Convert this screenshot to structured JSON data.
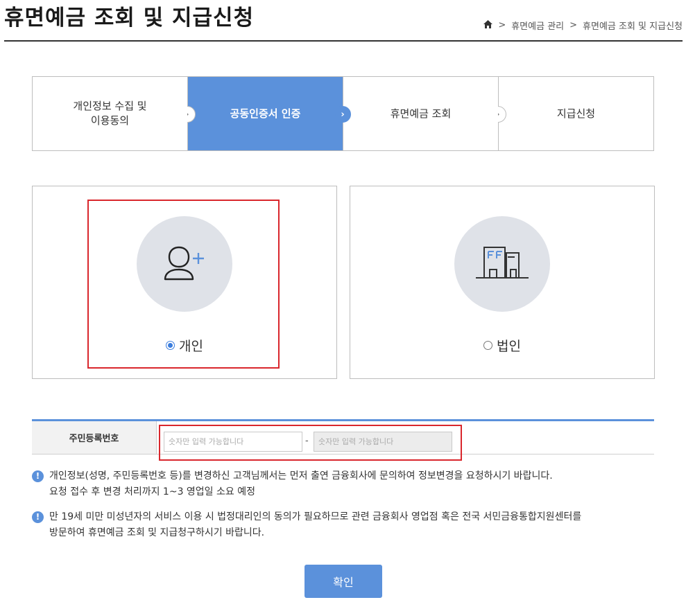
{
  "header": {
    "title": "휴면예금 조회 및 지급신청",
    "breadcrumb": {
      "home_icon": "home-icon",
      "items": [
        "휴면예금 관리",
        "휴면예금 조회 및 지급신청"
      ],
      "separator": ">"
    }
  },
  "steps": [
    {
      "label": "개인정보 수집 및\n이용동의",
      "active": false
    },
    {
      "label": "공동인증서 인증",
      "active": true
    },
    {
      "label": "휴면예금 조회",
      "active": false
    },
    {
      "label": "지급신청",
      "active": false
    }
  ],
  "step_arrow_glyph": "›",
  "member_types": {
    "personal": {
      "label": "개인",
      "icon": "person-add-icon",
      "selected": true
    },
    "corporate": {
      "label": "법인",
      "icon": "building-icon",
      "selected": false
    }
  },
  "rrn_form": {
    "label": "주민등록번호",
    "first_placeholder": "숫자만 입력 가능합니다",
    "second_placeholder": "숫자만 입력 가능합니다",
    "separator": "-"
  },
  "notices": [
    {
      "icon": "exclamation-icon",
      "glyph": "!",
      "text": "개인정보(성명, 주민등록번호 등)를 변경하신 고객님께서는 먼저 출연 금융회사에 문의하여 정보변경을 요청하시기 바랍니다.\n요청 접수 후 변경 처리까지 1~3 영업일 소요 예정"
    },
    {
      "icon": "exclamation-icon",
      "glyph": "!",
      "text": "만 19세 미만 미성년자의 서비스 이용 시 법정대리인의 동의가 필요하므로 관련 금융회사 영업점 혹은 전국 서민금융통합지원센터를\n방문하여 휴면예금 조회 및 지급청구하시기 바랍니다."
    }
  ],
  "confirm_label": "확인",
  "colors": {
    "accent": "#5b91db",
    "highlight": "#d9262c",
    "icon_circle": "#dfe2e8"
  }
}
